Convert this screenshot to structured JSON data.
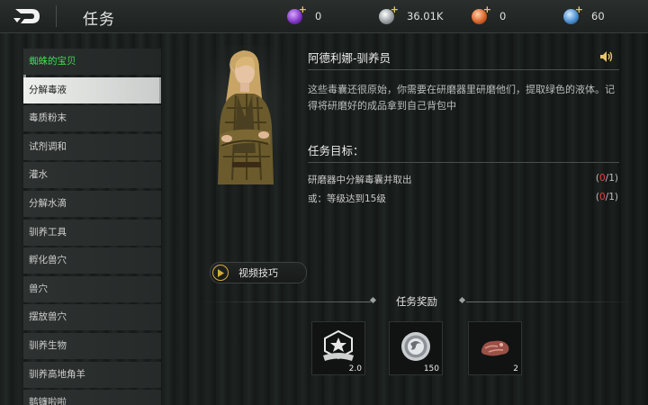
{
  "header": {
    "title": "任务",
    "currencies": [
      {
        "icon": "purple-gem-icon",
        "value": "0",
        "color": "#a04fd8"
      },
      {
        "icon": "silver-coin-icon",
        "value": "36.01K",
        "color": "#b8bcc0"
      },
      {
        "icon": "orange-coin-icon",
        "value": "0",
        "color": "#e07a3a"
      },
      {
        "icon": "blue-crystal-icon",
        "value": "60",
        "color": "#5aa0e0"
      }
    ]
  },
  "sidebar": {
    "items": [
      {
        "label": "蜘蛛的宝贝"
      },
      {
        "label": "分解毒液"
      },
      {
        "label": "毒质粉末"
      },
      {
        "label": "试剂调和"
      },
      {
        "label": "灌水"
      },
      {
        "label": "分解水滴"
      },
      {
        "label": "驯养工具"
      },
      {
        "label": "孵化兽穴"
      },
      {
        "label": "兽穴"
      },
      {
        "label": "摆放兽穴"
      },
      {
        "label": "驯养生物"
      },
      {
        "label": "驯养高地角羊"
      },
      {
        "label": "鹅镰啦啦"
      }
    ]
  },
  "quest": {
    "npc_name": "阿德利娜-驯养员",
    "description": "这些毒囊还很原始，你需要在研磨器里研磨他们，提取绿色的液体。记得将研磨好的成品拿到自己背包中",
    "objective_title": "任务目标：",
    "objectives": [
      {
        "text": "研磨器中分解毒囊并取出",
        "current": "0",
        "total": "/1)",
        "open": "("
      },
      {
        "text": "或：等级达到15级",
        "current": "0",
        "total": "/1)",
        "open": "("
      }
    ]
  },
  "video_button": {
    "label": "视频技巧"
  },
  "rewards": {
    "title": "任务奖励",
    "items": [
      {
        "icon": "badge-star-icon",
        "qty": "2.0"
      },
      {
        "icon": "silver-coin-icon",
        "qty": "150"
      },
      {
        "icon": "meat-chunk-icon",
        "qty": "2"
      }
    ]
  }
}
